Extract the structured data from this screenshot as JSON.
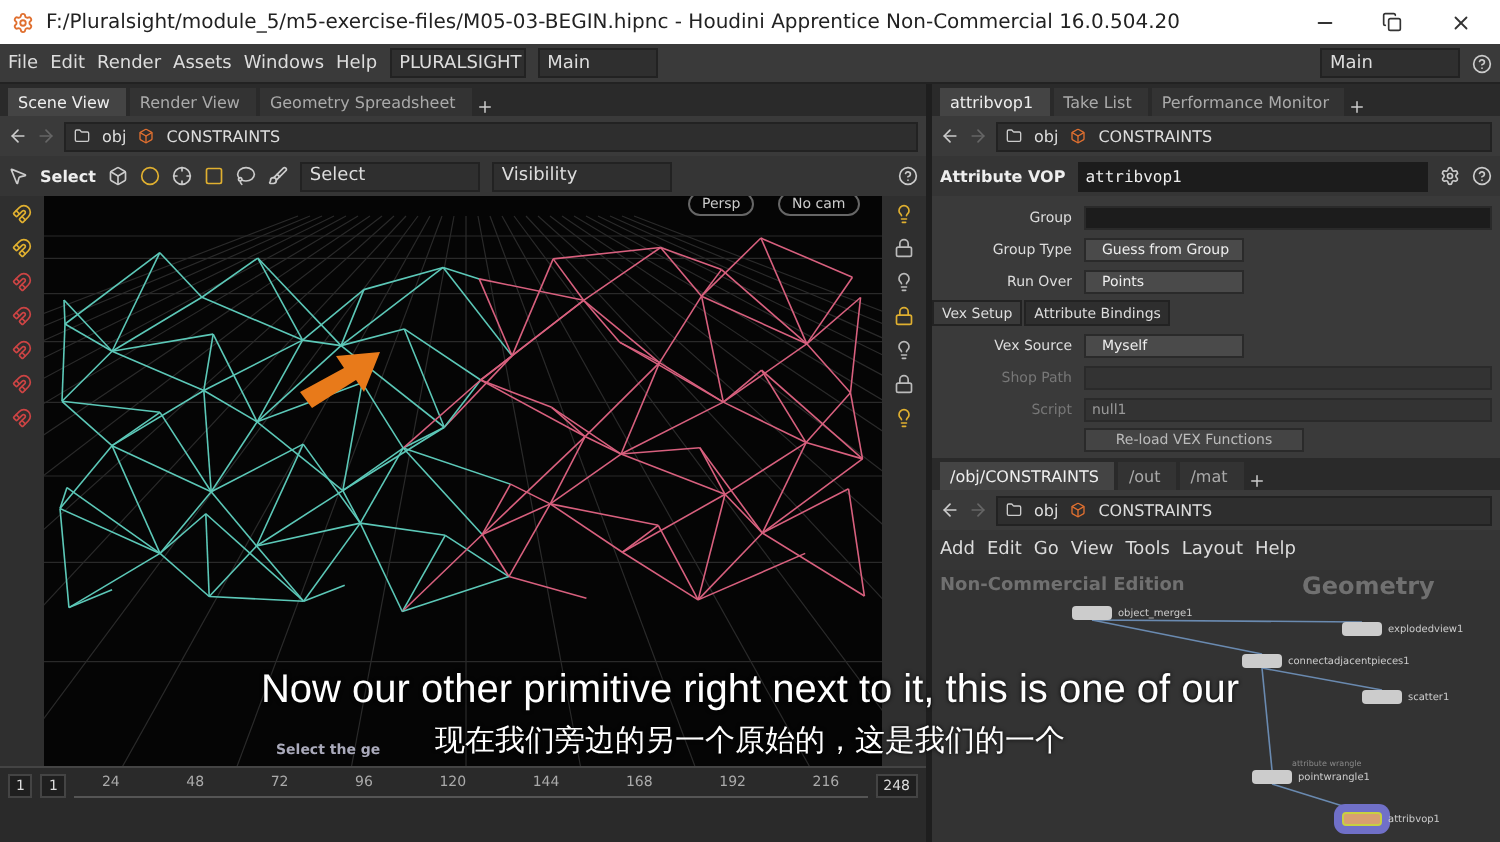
{
  "title_bar": {
    "title": "F:/Pluralsight/module_5/m5-exercise-files/M05-03-BEGIN.hipnc - Houdini Apprentice Non-Commercial 16.0.504.20"
  },
  "menu_bar": {
    "items": [
      "File",
      "Edit",
      "Render",
      "Assets",
      "Windows",
      "Help"
    ],
    "desktop": "PLURALSIGHT",
    "main": "Main",
    "right_main": "Main"
  },
  "scene_pane": {
    "tabs": [
      {
        "label": "Scene View",
        "selected": true
      },
      {
        "label": "Render View",
        "selected": false
      },
      {
        "label": "Geometry Spreadsheet",
        "selected": false
      }
    ],
    "path": [
      "obj",
      "CONSTRAINTS"
    ],
    "toolbar": {
      "select_tool": "Select",
      "mode": "Select",
      "visibility": "Visibility"
    },
    "view_buttons": [
      "Persp",
      "No cam"
    ],
    "hint": "Select the ge"
  },
  "timeline": {
    "start": "1",
    "frame": "1",
    "ticks": [
      "24",
      "48",
      "72",
      "96",
      "120",
      "144",
      "168",
      "192",
      "216"
    ],
    "end": "248"
  },
  "param_pane": {
    "tabs": [
      {
        "label": "attribvop1",
        "selected": true
      },
      {
        "label": "Take List",
        "selected": false
      },
      {
        "label": "Performance Monitor",
        "selected": false
      }
    ],
    "path": [
      "obj",
      "CONSTRAINTS"
    ],
    "node_type": "Attribute VOP",
    "node_name": "attribvop1",
    "params": [
      {
        "kind": "field",
        "label": "Group"
      },
      {
        "kind": "menu",
        "label": "Group Type",
        "value": "Guess from Group"
      },
      {
        "kind": "menu",
        "label": "Run Over",
        "value": "Points"
      }
    ],
    "subtabs": [
      {
        "label": "Vex Setup",
        "selected": true
      },
      {
        "label": "Attribute Bindings",
        "selected": false
      }
    ],
    "vex_params": [
      {
        "kind": "menu",
        "label": "Vex Source",
        "value": "Myself",
        "disabled": false
      },
      {
        "kind": "field",
        "label": "Shop Path",
        "disabled": true
      },
      {
        "kind": "field",
        "label": "Script",
        "value": "null1",
        "disabled": true
      }
    ],
    "reload_button": "Re-load VEX Functions"
  },
  "network_pane": {
    "tabs": [
      {
        "label": "/obj/CONSTRAINTS",
        "selected": true
      },
      {
        "label": "/out",
        "selected": false
      },
      {
        "label": "/mat",
        "selected": false
      }
    ],
    "path": [
      "obj",
      "CONSTRAINTS"
    ],
    "menu": [
      "Add",
      "Edit",
      "Go",
      "View",
      "Tools",
      "Layout",
      "Help"
    ],
    "edition": "Non-Commercial Edition",
    "context": "Geometry",
    "nodes": [
      {
        "name": "object_merge1",
        "selected": false
      },
      {
        "name": "explodedview1",
        "selected": false
      },
      {
        "name": "connectadjacentpieces1",
        "selected": false
      },
      {
        "name": "scatter1",
        "selected": false
      },
      {
        "name": "pointwrangle1",
        "comment": "attribute wrangle",
        "selected": false
      },
      {
        "name": "attribvop1",
        "selected": true
      }
    ]
  },
  "subtitles": [
    "Now our other primitive right next to it, this is one of our",
    "现在我们旁边的另一个原始的，这是我们的一个"
  ]
}
